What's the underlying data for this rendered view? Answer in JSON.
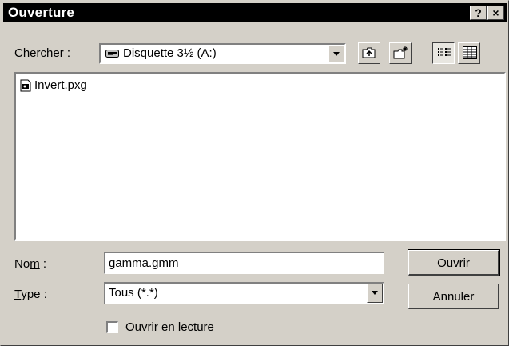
{
  "window": {
    "title": "Ouverture",
    "help_button": "?",
    "close_button": "×"
  },
  "lookin": {
    "label_pre": "Cherche",
    "label_key": "r",
    "label_post": " :",
    "value": "Disquette 3½ (A:)"
  },
  "toolbar": {
    "icons": [
      "up-folder-icon",
      "new-folder-icon",
      "list-view-icon",
      "details-view-icon"
    ],
    "active_view": "list"
  },
  "files": [
    {
      "name": "Invert.pxg",
      "icon": "image-file-icon"
    }
  ],
  "filename": {
    "label_pre": "No",
    "label_key": "m",
    "label_post": " :",
    "value": "gamma.gmm"
  },
  "filetype": {
    "label_pre": "",
    "label_key": "T",
    "label_post": "ype :",
    "value": "Tous (*.*)"
  },
  "buttons": {
    "open": {
      "pre": "",
      "key": "O",
      "post": "uvrir"
    },
    "cancel": {
      "label": "Annuler"
    }
  },
  "readonly": {
    "pre": "Ou",
    "key": "v",
    "post": "rir en lecture",
    "checked": false
  }
}
